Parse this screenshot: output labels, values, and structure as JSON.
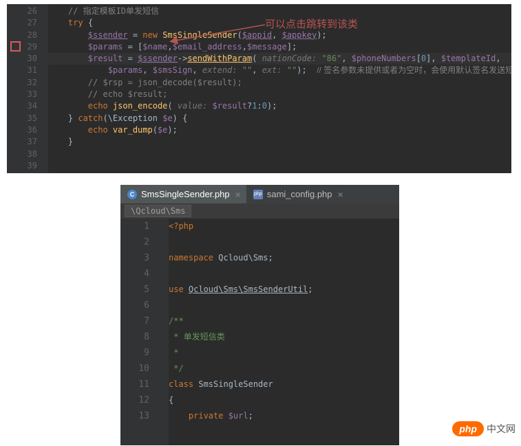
{
  "annotation": "可以点击跳转到该类",
  "top_editor": {
    "line_start": 26,
    "lines": [
      {
        "segments": [
          {
            "cls": "c-comment",
            "t": "// 指定模板ID单发短信"
          }
        ]
      },
      {
        "segments": [
          {
            "cls": "c-keyword",
            "t": "try "
          },
          {
            "cls": "",
            "t": "{"
          }
        ]
      },
      {
        "segments": [
          {
            "cls": "",
            "t": "    "
          },
          {
            "cls": "c-var-under",
            "t": "$ssender"
          },
          {
            "cls": "",
            "t": " = "
          },
          {
            "cls": "c-keyword",
            "t": "new "
          },
          {
            "cls": "c-type",
            "t": "SmsSingleSender"
          },
          {
            "cls": "",
            "t": "("
          },
          {
            "cls": "c-var-under",
            "t": "$appid"
          },
          {
            "cls": "",
            "t": ", "
          },
          {
            "cls": "c-var-under",
            "t": "$appkey"
          },
          {
            "cls": "",
            "t": ");"
          }
        ]
      },
      {
        "segments": [
          {
            "cls": "",
            "t": "    "
          },
          {
            "cls": "c-var",
            "t": "$params"
          },
          {
            "cls": "",
            "t": " = ["
          },
          {
            "cls": "c-var",
            "t": "$name"
          },
          {
            "cls": "",
            "t": ","
          },
          {
            "cls": "c-var",
            "t": "$email_address"
          },
          {
            "cls": "",
            "t": ","
          },
          {
            "cls": "c-var",
            "t": "$message"
          },
          {
            "cls": "",
            "t": "];"
          }
        ]
      },
      {
        "highlight": true,
        "segments": [
          {
            "cls": "",
            "t": "    "
          },
          {
            "cls": "c-var",
            "t": "$result"
          },
          {
            "cls": "",
            "t": " = "
          },
          {
            "cls": "c-var-under",
            "t": "$ssender"
          },
          {
            "cls": "",
            "t": "->"
          },
          {
            "cls": "c-method-under",
            "t": "sendWithParam"
          },
          {
            "cls": "",
            "t": "( "
          },
          {
            "cls": "c-hint",
            "t": "nationCode:"
          },
          {
            "cls": "",
            "t": " "
          },
          {
            "cls": "c-string",
            "t": "\"86\""
          },
          {
            "cls": "",
            "t": ", "
          },
          {
            "cls": "c-var",
            "t": "$phoneNumbers"
          },
          {
            "cls": "",
            "t": "["
          },
          {
            "cls": "c-num",
            "t": "0"
          },
          {
            "cls": "",
            "t": "], "
          },
          {
            "cls": "c-var",
            "t": "$templateId"
          },
          {
            "cls": "",
            "t": ","
          }
        ]
      },
      {
        "segments": [
          {
            "cls": "",
            "t": "        "
          },
          {
            "cls": "c-var",
            "t": "$params"
          },
          {
            "cls": "",
            "t": ", "
          },
          {
            "cls": "c-var",
            "t": "$smsSign"
          },
          {
            "cls": "",
            "t": ", "
          },
          {
            "cls": "c-hint",
            "t": "extend:"
          },
          {
            "cls": "",
            "t": " "
          },
          {
            "cls": "c-string",
            "t": "\"\""
          },
          {
            "cls": "",
            "t": ", "
          },
          {
            "cls": "c-hint",
            "t": "ext:"
          },
          {
            "cls": "",
            "t": " "
          },
          {
            "cls": "c-string",
            "t": "\"\""
          },
          {
            "cls": "",
            "t": ");  "
          },
          {
            "cls": "c-chinese-comment",
            "t": "// 签名参数未提供或者为空时，会使用默认签名发送短信"
          }
        ]
      },
      {
        "segments": [
          {
            "cls": "",
            "t": "    "
          },
          {
            "cls": "c-comment",
            "t": "// $rsp = json_decode($result);"
          }
        ]
      },
      {
        "segments": [
          {
            "cls": "",
            "t": "    "
          },
          {
            "cls": "c-comment",
            "t": "// echo $result;"
          }
        ]
      },
      {
        "segments": [
          {
            "cls": "",
            "t": "    "
          },
          {
            "cls": "c-keyword",
            "t": "echo "
          },
          {
            "cls": "c-method",
            "t": "json_encode"
          },
          {
            "cls": "",
            "t": "( "
          },
          {
            "cls": "c-hint",
            "t": "value:"
          },
          {
            "cls": "",
            "t": " "
          },
          {
            "cls": "c-var",
            "t": "$result"
          },
          {
            "cls": "",
            "t": "?"
          },
          {
            "cls": "c-num",
            "t": "1"
          },
          {
            "cls": "",
            "t": ":"
          },
          {
            "cls": "c-num",
            "t": "0"
          },
          {
            "cls": "",
            "t": ");"
          }
        ]
      },
      {
        "segments": [
          {
            "cls": "",
            "t": "} "
          },
          {
            "cls": "c-keyword",
            "t": "catch"
          },
          {
            "cls": "",
            "t": "(\\Exception "
          },
          {
            "cls": "c-var",
            "t": "$e"
          },
          {
            "cls": "",
            "t": ") {"
          }
        ]
      },
      {
        "segments": [
          {
            "cls": "",
            "t": "    "
          },
          {
            "cls": "c-keyword",
            "t": "echo "
          },
          {
            "cls": "c-method",
            "t": "var_dump"
          },
          {
            "cls": "",
            "t": "("
          },
          {
            "cls": "c-var",
            "t": "$e"
          },
          {
            "cls": "",
            "t": ");"
          }
        ]
      },
      {
        "segments": [
          {
            "cls": "",
            "t": "}"
          }
        ]
      },
      {
        "segments": [
          {
            "cls": "",
            "t": ""
          }
        ]
      }
    ]
  },
  "tabs": [
    {
      "icon": "class",
      "label": "SmsSingleSender.php",
      "active": true
    },
    {
      "icon": "php",
      "label": "sami_config.php",
      "active": false
    }
  ],
  "breadcrumb": "\\Qcloud\\Sms",
  "bottom_editor": {
    "line_start": 1,
    "lines": [
      {
        "segments": [
          {
            "cls": "c-phptag",
            "t": "<?php"
          }
        ]
      },
      {
        "segments": [
          {
            "cls": "",
            "t": ""
          }
        ]
      },
      {
        "segments": [
          {
            "cls": "c-keyword",
            "t": "namespace "
          },
          {
            "cls": "",
            "t": "Qcloud\\Sms;"
          }
        ]
      },
      {
        "segments": [
          {
            "cls": "",
            "t": ""
          }
        ]
      },
      {
        "segments": [
          {
            "cls": "c-keyword",
            "t": "use "
          },
          {
            "cls": "c-use",
            "t": "Qcloud\\Sms\\SmsSenderUtil"
          },
          {
            "cls": "",
            "t": ";"
          }
        ]
      },
      {
        "segments": [
          {
            "cls": "",
            "t": ""
          }
        ]
      },
      {
        "segments": [
          {
            "cls": "c-doc",
            "t": "/**"
          }
        ]
      },
      {
        "segments": [
          {
            "cls": "c-doc",
            "t": " * "
          },
          {
            "cls": "c-doc-cn",
            "t": "单发短信类"
          }
        ]
      },
      {
        "segments": [
          {
            "cls": "c-doc",
            "t": " *"
          }
        ]
      },
      {
        "segments": [
          {
            "cls": "c-doc",
            "t": " */"
          }
        ]
      },
      {
        "segments": [
          {
            "cls": "c-keyword",
            "t": "class "
          },
          {
            "cls": "",
            "t": "SmsSingleSender"
          }
        ]
      },
      {
        "segments": [
          {
            "cls": "",
            "t": "{"
          }
        ]
      },
      {
        "segments": [
          {
            "cls": "",
            "t": "    "
          },
          {
            "cls": "c-keyword",
            "t": "private "
          },
          {
            "cls": "c-var",
            "t": "$url"
          },
          {
            "cls": "",
            "t": ";"
          }
        ]
      }
    ]
  },
  "watermark": {
    "badge": "php",
    "text": "中文网"
  }
}
